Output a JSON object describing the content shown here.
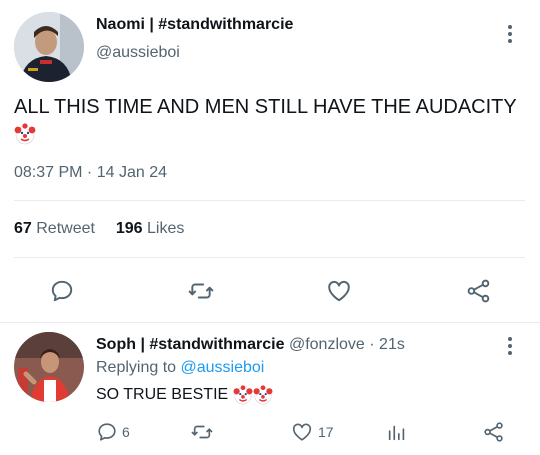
{
  "tweet": {
    "display_name": "Naomi | #standwithmarcie",
    "handle": "@aussieboi",
    "text": "ALL THIS TIME AND MEN STILL HAVE THE AUDACITY",
    "emoji": "clown-face",
    "timestamp": "08:37 PM · 14 Jan 24",
    "retweet_count": "67",
    "retweet_label": "Retweet",
    "like_count": "196",
    "like_label": "Likes"
  },
  "reply": {
    "display_name": "Soph | #standwithmarcie",
    "handle": "@fonzlove",
    "time": "· 21s",
    "replying_prefix": "Replying to",
    "replying_to": "@aussieboi",
    "text": "SO TRUE BESTIE",
    "reply_count": "6",
    "like_count": "17"
  },
  "colors": {
    "text": "#0f1419",
    "muted": "#536471",
    "link": "#1d9bf0",
    "divider": "#e6ecf0",
    "clown_red": "#e53935"
  },
  "icons": [
    "reply-icon",
    "retweet-icon",
    "like-icon",
    "share-icon",
    "more-icon",
    "views-icon"
  ]
}
